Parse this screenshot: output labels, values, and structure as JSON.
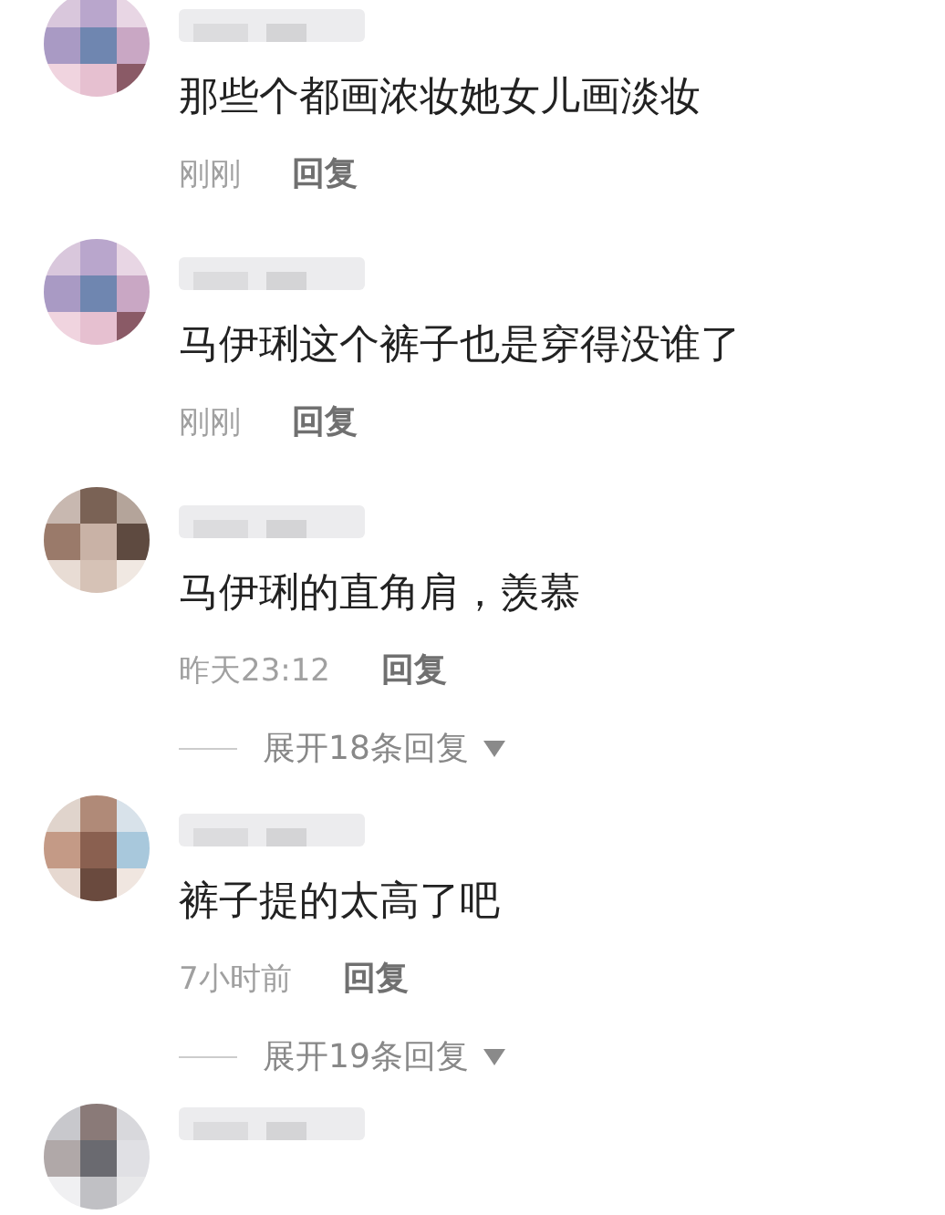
{
  "comments": [
    {
      "kind": "full",
      "text": "那些个都画浓妆她女儿画淡妆",
      "time": "刚刚",
      "reply": "回复"
    },
    {
      "kind": "full",
      "text": "马伊琍这个裤子也是穿得没谁了",
      "time": "刚刚",
      "reply": "回复"
    },
    {
      "kind": "full",
      "text": "马伊琍的直角肩，羡慕",
      "time": "昨天23:12",
      "reply": "回复",
      "expand": "展开18条回复"
    },
    {
      "kind": "full",
      "text": "裤子提的太高了吧",
      "time": "7小时前",
      "reply": "回复",
      "expand": "展开19条回复"
    },
    {
      "kind": "cut"
    }
  ]
}
